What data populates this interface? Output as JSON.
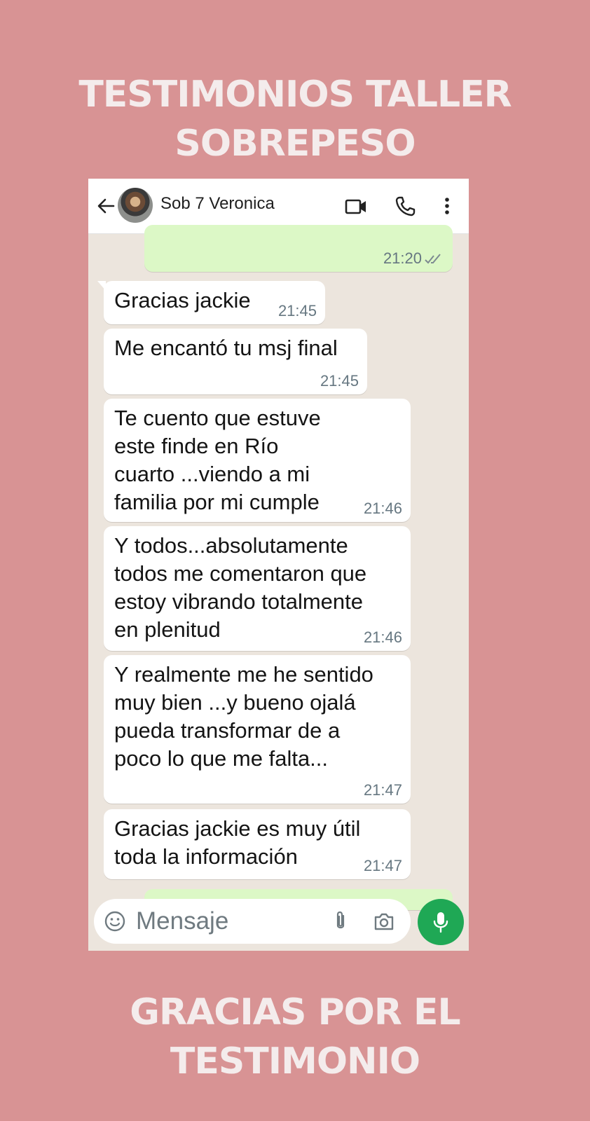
{
  "title": {
    "line1": "TESTIMONIOS TALLER",
    "line2": "SOBREPESO"
  },
  "footer": {
    "line1": "GRACIAS POR EL",
    "line2": "TESTIMONIO"
  },
  "chat_header": {
    "contact_name": "Sob 7 Veronica"
  },
  "messages": [
    {
      "direction": "outgoing",
      "text": "",
      "time": "21:20",
      "status": "read"
    },
    {
      "direction": "incoming",
      "text": "Gracias jackie",
      "time": "21:45"
    },
    {
      "direction": "incoming",
      "text": "Me encantó tu msj final",
      "time": "21:45"
    },
    {
      "direction": "incoming",
      "text": "Te cuento que estuve\neste finde en Río\ncuarto ...viendo a mi\nfamilia por mi cumple",
      "time": "21:46"
    },
    {
      "direction": "incoming",
      "text": "Y todos...absolutamente\ntodos me comentaron que\nestoy vibrando totalmente\nen plenitud",
      "time": "21:46"
    },
    {
      "direction": "incoming",
      "text": "Y realmente me he sentido\nmuy bien ...y bueno ojalá\npueda transformar de a\npoco lo que me falta...",
      "time": "21:47"
    },
    {
      "direction": "incoming",
      "text": "Gracias jackie es muy útil\ntoda la información",
      "time": "21:47"
    }
  ],
  "composer": {
    "placeholder": "Mensaje"
  },
  "colors": {
    "background": "#d89394",
    "accent": "#1fa855",
    "outgoing_bubble": "#dcf8c6"
  }
}
